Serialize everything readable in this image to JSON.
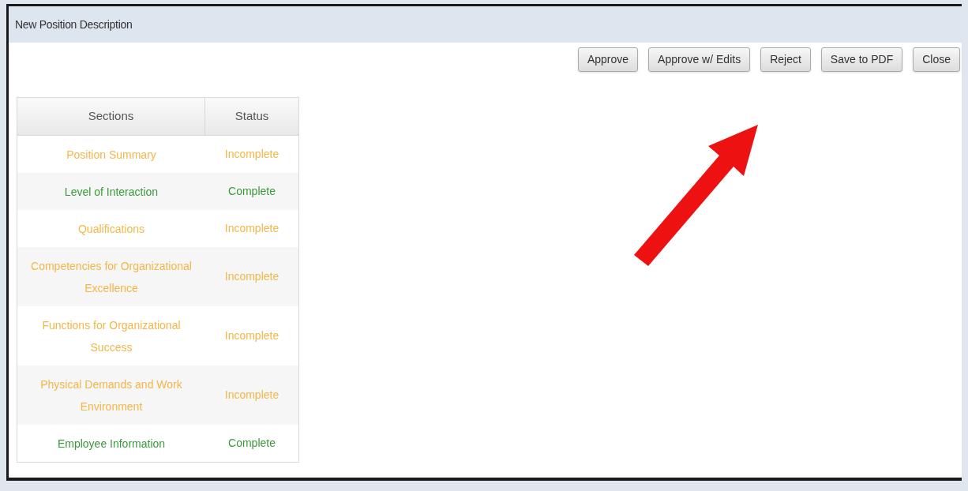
{
  "window": {
    "title": "New Position Description"
  },
  "buttons": [
    "Approve",
    "Approve w/ Edits",
    "Reject",
    "Save to PDF",
    "Close"
  ],
  "table": {
    "columns": [
      "Sections",
      "Status"
    ],
    "rows": [
      {
        "section": "Position Summary",
        "status": "Incomplete",
        "complete": false
      },
      {
        "section": "Level of Interaction",
        "status": "Complete",
        "complete": true
      },
      {
        "section": "Qualifications",
        "status": "Incomplete",
        "complete": false
      },
      {
        "section": "Competencies for Organizational Excellence",
        "status": "Incomplete",
        "complete": false
      },
      {
        "section": "Functions for Organizational Success",
        "status": "Incomplete",
        "complete": false
      },
      {
        "section": "Physical Demands and Work Environment",
        "status": "Incomplete",
        "complete": false
      },
      {
        "section": "Employee Information",
        "status": "Complete",
        "complete": true
      }
    ]
  }
}
